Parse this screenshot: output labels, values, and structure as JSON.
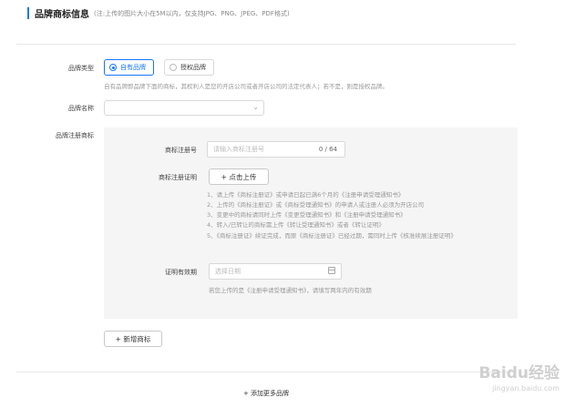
{
  "header": {
    "title": "品牌商标信息",
    "note": "(注:上传的图片大小在5M以内，仅支持JPG、PNG、JPEG、PDF格式)"
  },
  "brand_type": {
    "label": "品牌类型",
    "options": [
      "自有品牌",
      "授权品牌"
    ],
    "selected": "自有品牌",
    "hint": "自有品牌即品牌下面的商标，其权利人是您的开店公司或者开店公司的法定代表人；若不是，则是授权品牌。"
  },
  "brand_name": {
    "label": "品牌名称",
    "value": ""
  },
  "trademark": {
    "section_label": "品牌注册商标",
    "reg_no_label": "商标注册号",
    "reg_no_placeholder": "请输入商标注册号",
    "reg_no_count": "0 / 64",
    "cert_label": "商标注册证明",
    "upload_label": "+ 点击上传",
    "rules": [
      "1、请上传《商标注册证》或申请日起已满6个月的《注册申请受理通知书》",
      "2、上传的《商标注册证》或《商标受理通知书》的申请人或注册人必须为开店公司",
      "3、变更中的商标请同时上传《变更受理通知书》和《注册申请受理通知书》",
      "4、转入/已转让的商标需上传《转让受理通知书》或者《转让证明》",
      "5、《商标注册证》续证完成，而原《商标注册证》已经过期，需同时上传《核准续展注册证明》"
    ],
    "validity_label": "证明有效期",
    "date_placeholder": "选择日期",
    "validity_hint": "若您上传的是《注册申请受理通知书》，请填写两年内的有效期"
  },
  "add_trademark_label": "+ 新增商标",
  "add_brand_label": "+ 添加更多品牌",
  "watermark": {
    "brand": "Baidu经验",
    "url": "jingyan.baidu.com"
  }
}
